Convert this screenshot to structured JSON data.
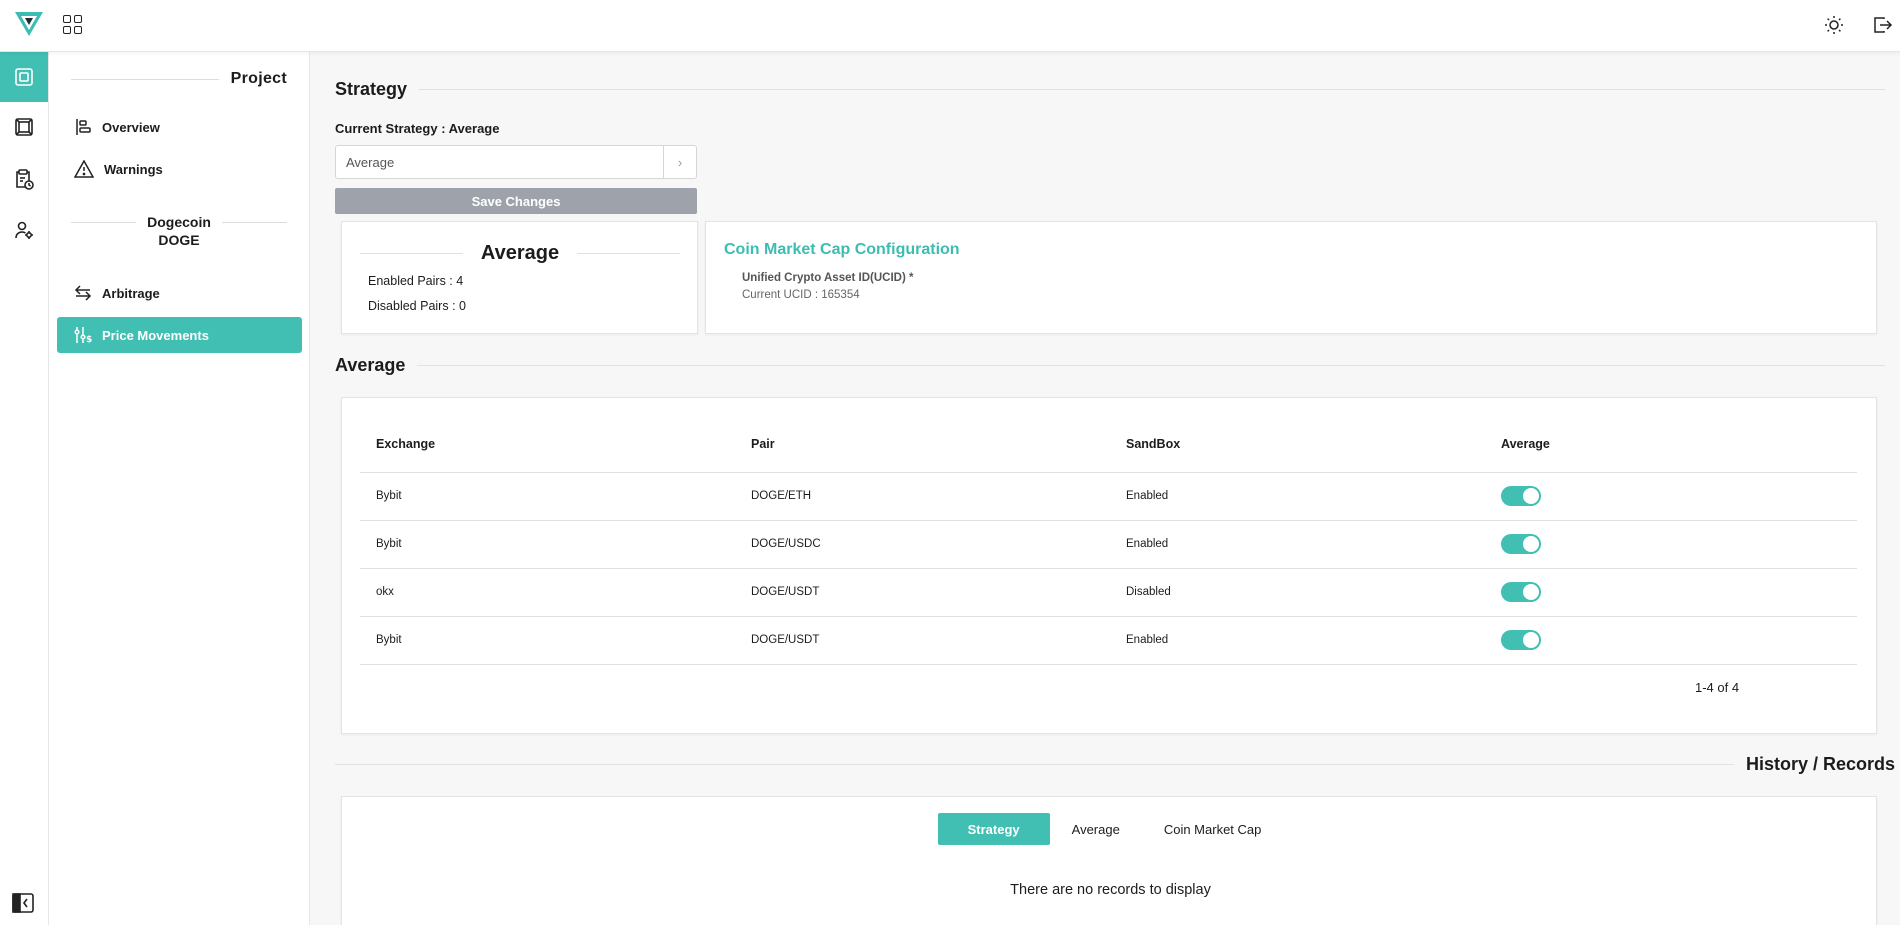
{
  "sidepanel": {
    "project_title": "Project",
    "nav": [
      {
        "label": "Overview",
        "icon": "overview-icon"
      },
      {
        "label": "Warnings",
        "icon": "warning-icon"
      }
    ],
    "coin_name": "Dogecoin",
    "coin_symbol": "DOGE",
    "coin_nav": [
      {
        "label": "Arbitrage",
        "icon": "arbitrage-icon"
      },
      {
        "label": "Price Movements",
        "icon": "sliders-icon"
      }
    ]
  },
  "strategy": {
    "title": "Strategy",
    "current_label": "Current Strategy : Average",
    "select_value": "Average",
    "save_label": "Save Changes"
  },
  "summary": {
    "title": "Average",
    "enabled_pairs": "Enabled Pairs : 4",
    "disabled_pairs": "Disabled Pairs : 0"
  },
  "cmc": {
    "title": "Coin Market Cap Configuration",
    "ucid_label": "Unified Crypto Asset ID(UCID) *",
    "ucid_value": "Current UCID : 165354"
  },
  "average": {
    "title": "Average",
    "columns": [
      "Exchange",
      "Pair",
      "SandBox",
      "Average"
    ],
    "rows": [
      {
        "exchange": "Bybit",
        "pair": "DOGE/ETH",
        "sandbox": "Enabled",
        "average": true
      },
      {
        "exchange": "Bybit",
        "pair": "DOGE/USDC",
        "sandbox": "Enabled",
        "average": true
      },
      {
        "exchange": "okx",
        "pair": "DOGE/USDT",
        "sandbox": "Disabled",
        "average": true
      },
      {
        "exchange": "Bybit",
        "pair": "DOGE/USDT",
        "sandbox": "Enabled",
        "average": true
      }
    ],
    "pagination": "1-4 of 4"
  },
  "history": {
    "title": "History / Records",
    "tabs": [
      "Strategy",
      "Average",
      "Coin Market Cap"
    ],
    "active_tab": "Strategy",
    "empty_text": "There are no records to display"
  },
  "colors": {
    "accent": "#41bfb3",
    "save_button": "#9ea3ab"
  }
}
